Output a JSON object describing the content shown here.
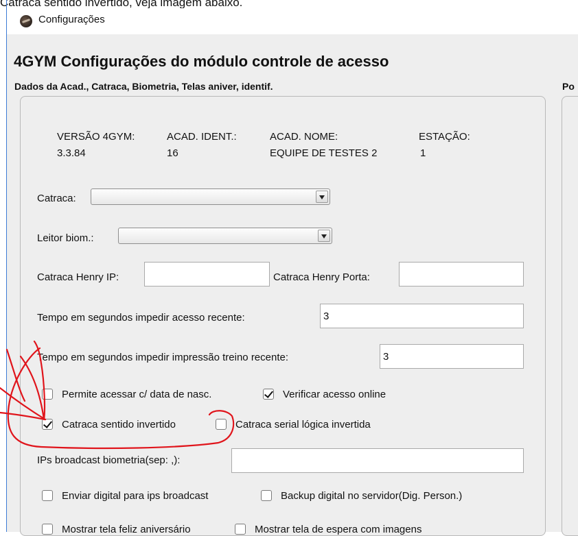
{
  "caption": "Catraca sentido invertido, veja imagem abaixo.",
  "window": {
    "title": "Configurações"
  },
  "heading": "4GYM Configurações do módulo controle de acesso",
  "section": {
    "title": "Dados da Acad., Catraca, Biometria, Telas aniver, identif.",
    "title_2": "Po"
  },
  "info": {
    "versao_label": "VERSÃO 4GYM:",
    "versao_value": "3.3.84",
    "ident_label": "ACAD. IDENT.:",
    "ident_value": "16",
    "nome_label": "ACAD. NOME:",
    "nome_value": "EQUIPE DE TESTES 2",
    "estacao_label": "ESTAÇÃO:",
    "estacao_value": "1"
  },
  "fields": {
    "catraca_label": "Catraca:",
    "catraca_value": "",
    "leitor_label": "Leitor biom.:",
    "leitor_value": "",
    "henry_ip_label": "Catraca Henry IP:",
    "henry_ip_value": "",
    "henry_porta_label": "Catraca Henry Porta:",
    "henry_porta_value": "",
    "tempo_acesso_label": "Tempo em segundos impedir acesso recente:",
    "tempo_acesso_value": "3",
    "tempo_impressao_label": "Tempo em segundos impedir impressão treino recente:",
    "tempo_impressao_value": "3",
    "ips_label": "IPs broadcast biometria(sep: ,):",
    "ips_value": ""
  },
  "checkboxes": {
    "permite_nasc": {
      "label": "Permite acessar c/ data de nasc.",
      "checked": false
    },
    "verificar_online": {
      "label": "Verificar acesso online",
      "checked": true
    },
    "sentido_invertido": {
      "label": "Catraca sentido invertido",
      "checked": true
    },
    "serial_invertida": {
      "label": "Catraca serial lógica invertida",
      "checked": false
    },
    "enviar_digital": {
      "label": "Enviar digital para ips broadcast",
      "checked": false
    },
    "backup_digital": {
      "label": "Backup digital no servidor(Dig. Person.)",
      "checked": false
    },
    "feliz_aniversario": {
      "label": "Mostrar tela feliz aniversário",
      "checked": false
    },
    "tela_espera": {
      "label": "Mostrar tela de espera com imagens",
      "checked": false
    }
  },
  "colors": {
    "annotation": "#e0141b",
    "window_bg": "#eeeeee",
    "accent_line": "#3c7bd6"
  }
}
